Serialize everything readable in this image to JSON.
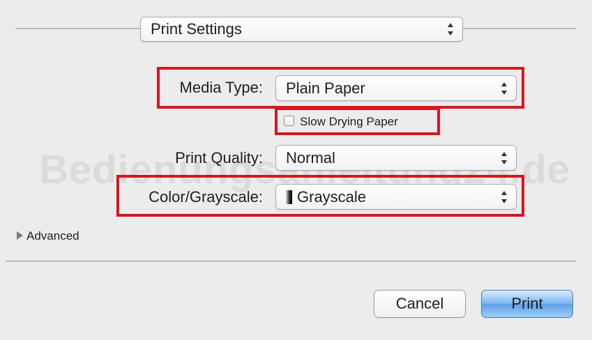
{
  "print_settings": {
    "section_menu": "Print Settings",
    "media_type": {
      "label": "Media Type:",
      "value": "Plain Paper"
    },
    "slow_drying": {
      "label": "Slow Drying Paper",
      "checked": false
    },
    "print_quality": {
      "label": "Print Quality:",
      "value": "Normal"
    },
    "color_grayscale": {
      "label": "Color/Grayscale:",
      "value": "Grayscale"
    },
    "advanced": {
      "label": "Advanced"
    }
  },
  "watermark": "Bedienungsanleitung24.de",
  "buttons": {
    "cancel": "Cancel",
    "print": "Print"
  },
  "colors": {
    "highlight": "#d4171f",
    "default_button": "#5e9fe6"
  },
  "icons": [
    "up-down-arrows-icon",
    "disclosure-triangle-icon",
    "grayscale-swatch-icon"
  ]
}
